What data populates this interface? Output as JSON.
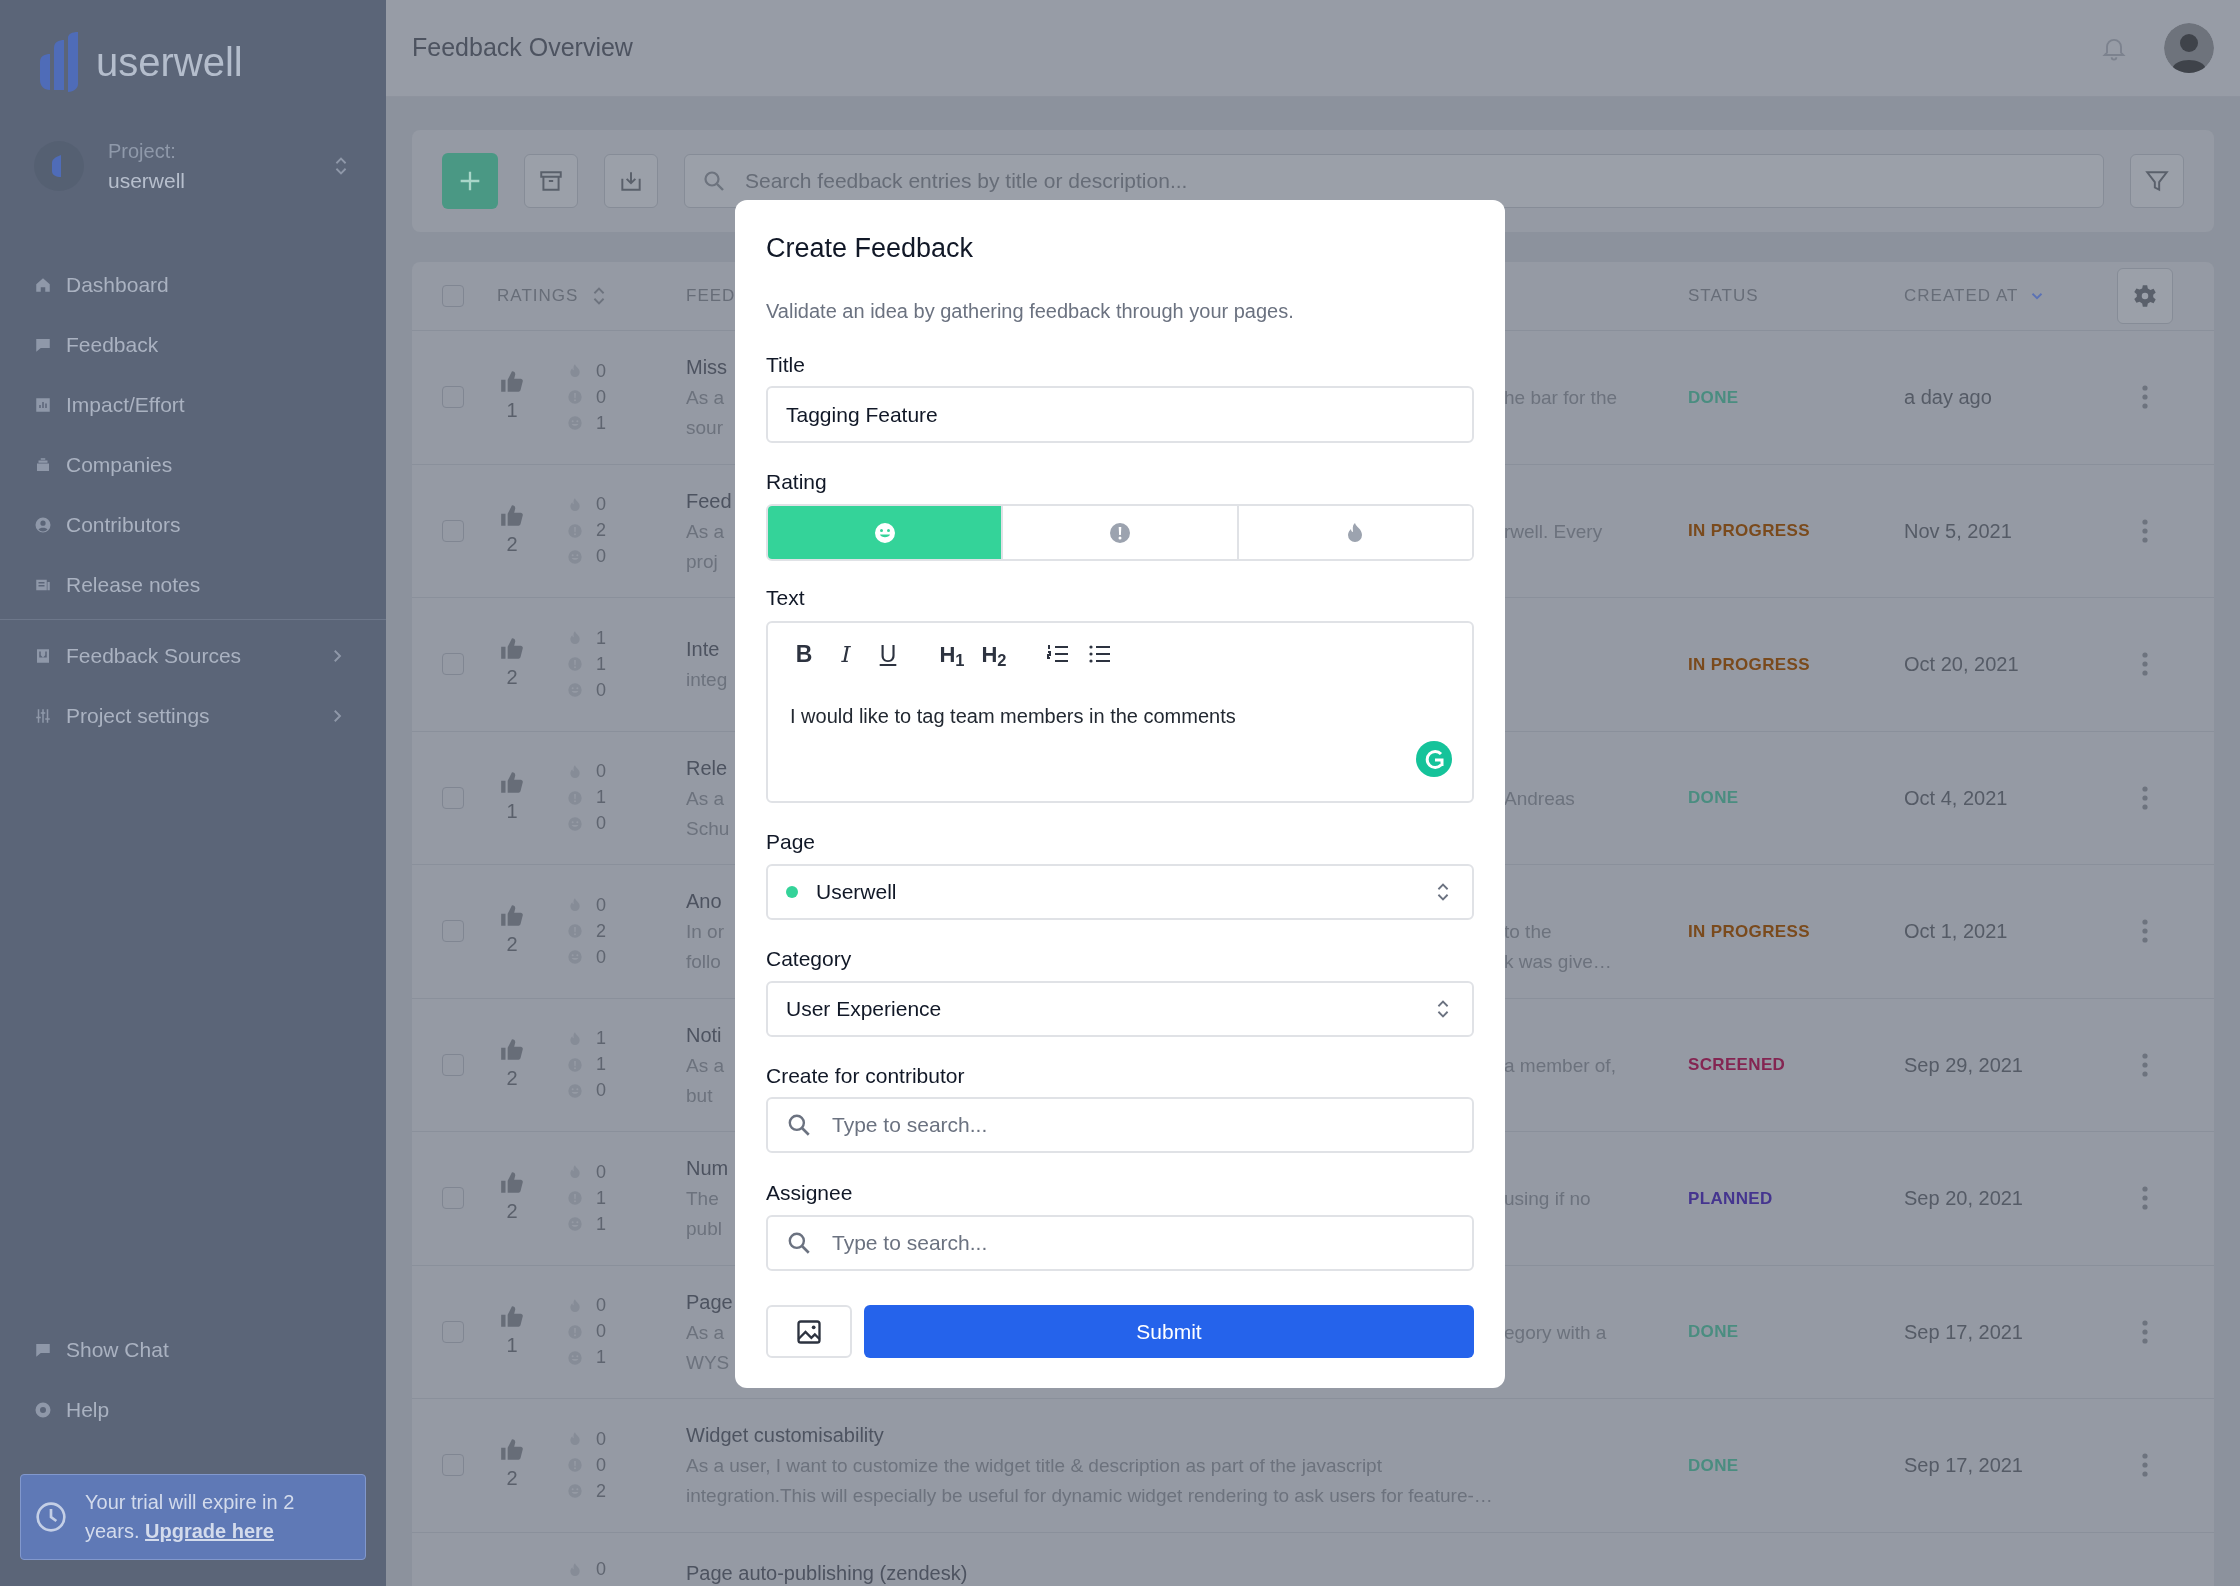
{
  "sidebar": {
    "logo": "userwell",
    "project_label": "Project:",
    "project_name": "userwell",
    "nav": [
      {
        "label": "Dashboard"
      },
      {
        "label": "Feedback"
      },
      {
        "label": "Impact/Effort"
      },
      {
        "label": "Companies"
      },
      {
        "label": "Contributors"
      },
      {
        "label": "Release notes"
      }
    ],
    "sections": [
      {
        "label": "Feedback Sources"
      },
      {
        "label": "Project settings"
      }
    ],
    "footer": [
      {
        "label": "Show Chat"
      },
      {
        "label": "Help"
      }
    ],
    "trial": {
      "text": "Your trial will expire in 2 years.",
      "link": "Upgrade here"
    }
  },
  "header": {
    "title": "Feedback Overview"
  },
  "toolbar": {
    "search_placeholder": "Search feedback entries by title or description..."
  },
  "table": {
    "select_all_checked": false,
    "columns": [
      {
        "label": "RATINGS"
      },
      {
        "label": "FEED"
      },
      {
        "label": "STATUS"
      },
      {
        "label": "CREATED AT"
      }
    ],
    "rows": [
      {
        "checked": false,
        "votes": "1",
        "counts": [
          {
            "kind": "fire",
            "value": "0"
          },
          {
            "kind": "alert",
            "value": "0"
          },
          {
            "kind": "smile",
            "value": "1"
          }
        ],
        "title": "Miss",
        "description": [
          "As a",
          "sour"
        ],
        "description_right": [
          "he bar for the"
        ],
        "status": {
          "label": "DONE",
          "color": "#4a8d80"
        },
        "created": "a day ago"
      },
      {
        "checked": false,
        "votes": "2",
        "counts": [
          {
            "kind": "fire",
            "value": "0"
          },
          {
            "kind": "alert",
            "value": "2"
          },
          {
            "kind": "smile",
            "value": "0"
          }
        ],
        "title": "Feed",
        "description": [
          "As a",
          "proj"
        ],
        "description_right": [
          "rwell. Every"
        ],
        "status": {
          "label": "IN PROGRESS",
          "color": "#7a4a1c"
        },
        "created": "Nov 5, 2021"
      },
      {
        "checked": false,
        "votes": "2",
        "counts": [
          {
            "kind": "fire",
            "value": "1"
          },
          {
            "kind": "alert",
            "value": "1"
          },
          {
            "kind": "smile",
            "value": "0"
          }
        ],
        "title": "Inte",
        "description": [
          "integ"
        ],
        "status": {
          "label": "IN PROGRESS",
          "color": "#7a4a1c"
        },
        "created": "Oct 20, 2021"
      },
      {
        "checked": false,
        "votes": "1",
        "counts": [
          {
            "kind": "fire",
            "value": "0"
          },
          {
            "kind": "alert",
            "value": "1"
          },
          {
            "kind": "smile",
            "value": "0"
          }
        ],
        "title": "Rele",
        "description": [
          "As a",
          "Schu"
        ],
        "description_right": [
          "Andreas"
        ],
        "status": {
          "label": "DONE",
          "color": "#4a8d80"
        },
        "created": "Oct 4, 2021"
      },
      {
        "checked": false,
        "votes": "2",
        "counts": [
          {
            "kind": "fire",
            "value": "0"
          },
          {
            "kind": "alert",
            "value": "2"
          },
          {
            "kind": "smile",
            "value": "0"
          }
        ],
        "title": "Ano",
        "description": [
          "In or",
          "follo"
        ],
        "description_right": [
          "to the",
          "k was give…"
        ],
        "status": {
          "label": "IN PROGRESS",
          "color": "#7a4a1c"
        },
        "created": "Oct 1, 2021"
      },
      {
        "checked": false,
        "votes": "2",
        "counts": [
          {
            "kind": "fire",
            "value": "1"
          },
          {
            "kind": "alert",
            "value": "1"
          },
          {
            "kind": "smile",
            "value": "0"
          }
        ],
        "title": "Noti",
        "description": [
          "As a",
          "but"
        ],
        "description_right": [
          "a member of,"
        ],
        "status": {
          "label": "SCREENED",
          "color": "#842552"
        },
        "created": "Sep 29, 2021"
      },
      {
        "checked": false,
        "votes": "2",
        "counts": [
          {
            "kind": "fire",
            "value": "0"
          },
          {
            "kind": "alert",
            "value": "1"
          },
          {
            "kind": "smile",
            "value": "1"
          }
        ],
        "title": "Num",
        "description": [
          "The",
          "publ"
        ],
        "description_right": [
          "using if no"
        ],
        "status": {
          "label": "PLANNED",
          "color": "#45358f"
        },
        "created": "Sep 20, 2021"
      },
      {
        "checked": false,
        "votes": "1",
        "counts": [
          {
            "kind": "fire",
            "value": "0"
          },
          {
            "kind": "alert",
            "value": "0"
          },
          {
            "kind": "smile",
            "value": "1"
          }
        ],
        "title": "Page",
        "description": [
          "As a",
          "WYS"
        ],
        "description_right": [
          "egory with a"
        ],
        "status": {
          "label": "DONE",
          "color": "#4a8d80"
        },
        "created": "Sep 17, 2021"
      },
      {
        "checked": false,
        "votes": "2",
        "counts": [
          {
            "kind": "fire",
            "value": "0"
          },
          {
            "kind": "alert",
            "value": "0"
          },
          {
            "kind": "smile",
            "value": "2"
          }
        ],
        "title": "Widget customisability",
        "description": [
          "As a user, I want to customize the widget title & description as part of the javascript",
          "integration.This will especially be useful for dynamic widget rendering to ask users for feature-…"
        ],
        "status": {
          "label": "DONE",
          "color": "#4a8d80"
        },
        "created": "Sep 17, 2021"
      },
      {
        "counts": [
          {
            "kind": "fire",
            "value": "0"
          }
        ],
        "title": "Page auto-publishing (zendesk)"
      }
    ]
  },
  "modal": {
    "title": "Create Feedback",
    "subtitle": "Validate an idea by gathering feedback through your pages.",
    "title_label": "Title",
    "title_value": "Tagging Feature",
    "rating_label": "Rating",
    "rating": [
      {
        "kind": "smile",
        "selected": true
      },
      {
        "kind": "alert",
        "selected": false
      },
      {
        "kind": "fire",
        "selected": false
      }
    ],
    "text_label": "Text",
    "editor_tools": [
      {
        "kind": "bold",
        "label": "B"
      },
      {
        "kind": "italic",
        "label": "I"
      },
      {
        "kind": "underline",
        "label": "U"
      },
      {
        "kind": "heading",
        "label": "H$_{1}$"
      },
      {
        "kind": "heading",
        "label": "H$_{2}$"
      },
      {
        "kind": "ordered-list"
      },
      {
        "kind": "bullet-list"
      }
    ],
    "text_value": "I would like to tag team members in the comments",
    "page_label": "Page",
    "page_value": "Userwell",
    "category_label": "Category",
    "category_value": "User Experience",
    "contributor_label": "Create for contributor",
    "contributor_placeholder": "Type to search...",
    "assignee_label": "Assignee",
    "assignee_placeholder": "Type to search...",
    "submit": "Submit"
  }
}
